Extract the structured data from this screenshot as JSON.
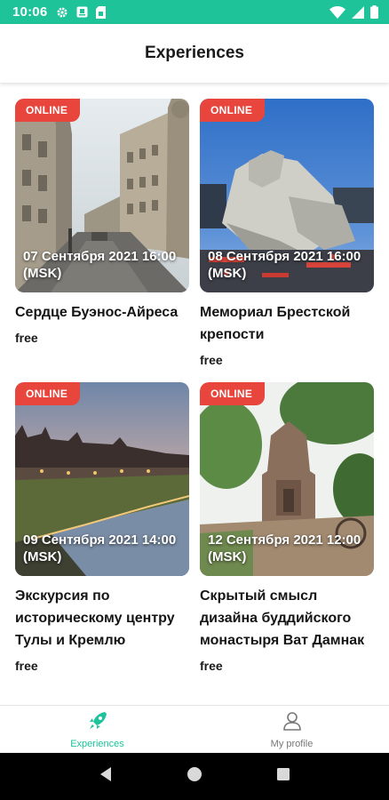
{
  "status_bar": {
    "time": "10:06",
    "left_icons": [
      "gear-icon",
      "notification-icon",
      "sim-icon"
    ],
    "right_icons": [
      "wifi-icon",
      "signal-icon",
      "battery-icon"
    ],
    "background": "#1ec39a"
  },
  "header": {
    "title": "Experiences"
  },
  "cards": [
    {
      "badge": "ONLINE",
      "date_line1": "07 Сентября 2021 16:00",
      "date_line2": "(MSK)",
      "title": "Сердце Буэнос-Айреса",
      "price": "free"
    },
    {
      "badge": "ONLINE",
      "date_line1": "08 Сентября 2021 16:00",
      "date_line2": "(MSK)",
      "title": "Мемориал Брестской крепости",
      "price": "free"
    },
    {
      "badge": "ONLINE",
      "date_line1": "09 Сентября 2021 14:00",
      "date_line2": "(MSK)",
      "title": "Экскурсия по историческому центру Тулы и Кремлю",
      "price": "free"
    },
    {
      "badge": "ONLINE",
      "date_line1": "12 Сентября 2021 12:00",
      "date_line2": "(MSK)",
      "title": "Скрытый смысл дизайна буддийского монастыря Ват Дамнак",
      "price": "free"
    }
  ],
  "bottom_nav": {
    "items": [
      {
        "label": "Experiences",
        "icon": "rocket-icon",
        "active": true
      },
      {
        "label": "My profile",
        "icon": "person-icon",
        "active": false
      }
    ],
    "accent": "#1ec39a"
  },
  "system_nav": {
    "icons": [
      "back-icon",
      "home-icon",
      "recents-icon"
    ]
  },
  "colors": {
    "badge": "#e8453c",
    "accent": "#1ec39a"
  }
}
